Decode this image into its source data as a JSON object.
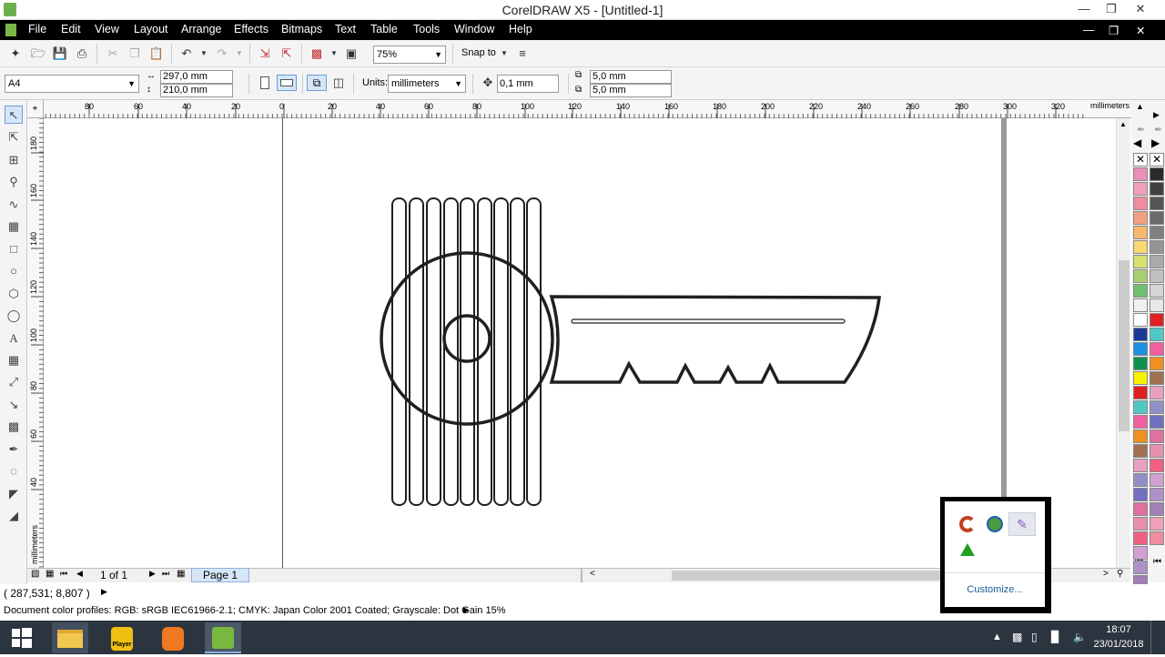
{
  "window": {
    "title": "CorelDRAW X5 - [Untitled-1]"
  },
  "menu": [
    "File",
    "Edit",
    "View",
    "Layout",
    "Arrange",
    "Effects",
    "Bitmaps",
    "Text",
    "Table",
    "Tools",
    "Window",
    "Help"
  ],
  "toolbar": {
    "zoom": "75%",
    "snap_to": "Snap to"
  },
  "property_bar": {
    "page_size": "A4",
    "width": "297,0 mm",
    "height": "210,0 mm",
    "units_label": "Units:",
    "units": "millimeters",
    "nudge": "0,1 mm",
    "dup_x": "5,0 mm",
    "dup_y": "5,0 mm"
  },
  "rulers": {
    "unit": "millimeters",
    "h_ticks": [
      "80",
      "60",
      "40",
      "20",
      "0",
      "20",
      "40",
      "60",
      "80",
      "100",
      "120",
      "140",
      "160",
      "180",
      "200",
      "220",
      "240",
      "260",
      "280",
      "300",
      "320"
    ],
    "v_ticks": [
      "180",
      "160",
      "140",
      "120",
      "100",
      "80",
      "60",
      "40"
    ]
  },
  "navigator": {
    "page_count": "1 of 1",
    "page_tab": "Page 1"
  },
  "status": {
    "coords": "( 287,531; 8,807 )",
    "color_profiles": "Document color profiles: RGB: sRGB IEC61966-2.1; CMYK: Japan Color 2001 Coated; Grayscale: Dot Gain 15%"
  },
  "tray": {
    "customize": "Customize..."
  },
  "taskbar": {
    "time": "18:07",
    "date": "23/01/2018",
    "player": "Player"
  },
  "palette_colors": [
    "#f0a0b8",
    "#f08ca0",
    "#f4a080",
    "#f7b870",
    "#f8d870",
    "#d8e070",
    "#a8d070",
    "#70c070",
    "#f0f0f0",
    "#ffffff",
    "#1a3a9a",
    "#1a90e0",
    "#109050",
    "#f8f000",
    "#e02020",
    "#50c8c8",
    "#f060a0",
    "#f09020",
    "#a07050",
    "#e8a0c0",
    "#9090c8",
    "#7070c0",
    "#e070a0",
    "#e890b0",
    "#f06080",
    "#d0a0d0",
    "#b090c8",
    "#a080b8"
  ],
  "palette_grays": [
    "#2a2a2a",
    "#404040",
    "#555555",
    "#6a6a6a",
    "#808080",
    "#959595",
    "#aaaaaa",
    "#c0c0c0",
    "#d5d5d5",
    "#e8e8e8"
  ]
}
